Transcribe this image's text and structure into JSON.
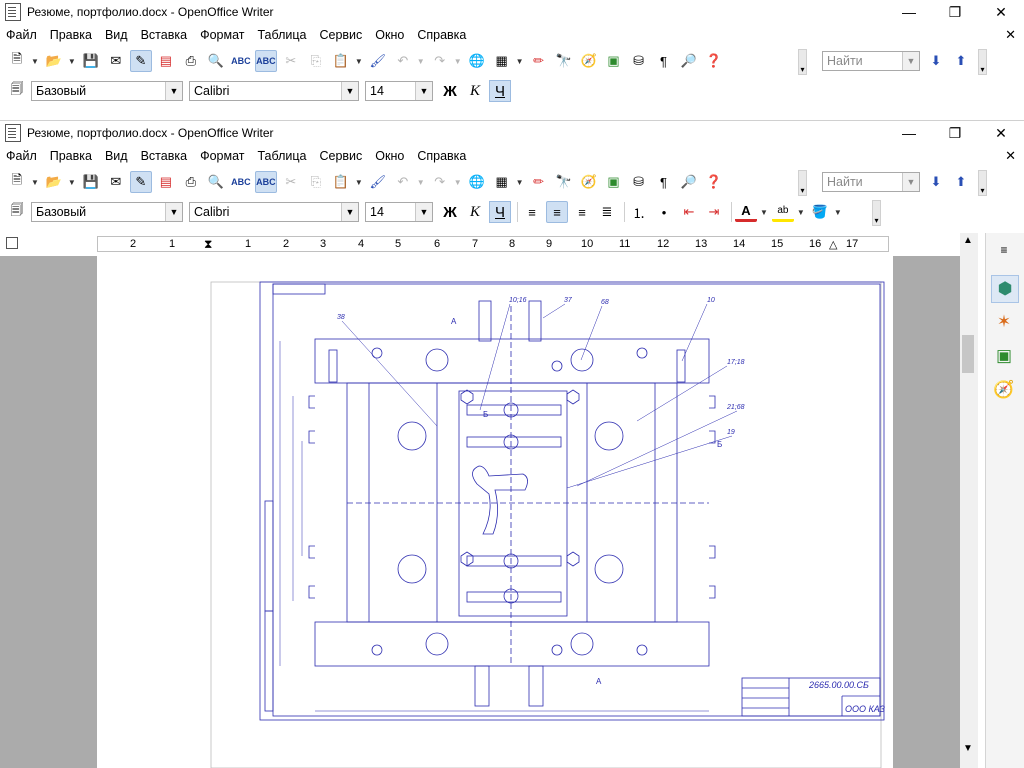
{
  "window": {
    "title": "Резюме, портфолио.docx - OpenOffice Writer",
    "controls": {
      "minimize": "—",
      "restore": "❐",
      "close": "✕"
    }
  },
  "menu": {
    "items": [
      "Файл",
      "Правка",
      "Вид",
      "Вставка",
      "Формат",
      "Таблица",
      "Сервис",
      "Окно",
      "Справка"
    ],
    "close": "✕"
  },
  "toolbar": {
    "find_placeholder": "Найти"
  },
  "format": {
    "style": "Базовый",
    "font": "Calibri",
    "size": "14",
    "bold": "Ж",
    "italic": "К",
    "underline": "Ч"
  },
  "ruler": {
    "left_labels": [
      "2",
      "1"
    ],
    "right_labels": [
      "1",
      "2",
      "3",
      "4",
      "5",
      "6",
      "7",
      "8",
      "9",
      "10",
      "11",
      "12",
      "13",
      "14",
      "15",
      "16",
      "17"
    ]
  },
  "drawing": {
    "title_block_code": "2665.00.00.СБ",
    "company": "ООО КАЗ",
    "callouts": [
      "38",
      "10;16",
      "37",
      "68",
      "10",
      "17;18",
      "21;68",
      "19"
    ],
    "section_labels": [
      "А",
      "Б",
      "Б",
      "А"
    ]
  },
  "colors": {
    "accent_blue": "#2a4fb5",
    "drawing_line": "#2c2cb0",
    "red_icon": "#d62b2b"
  }
}
